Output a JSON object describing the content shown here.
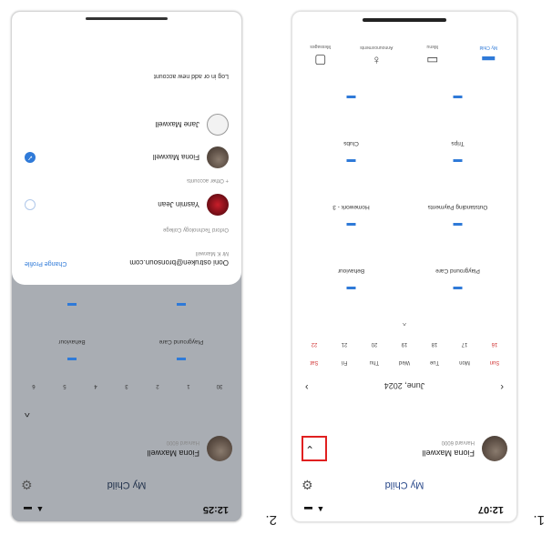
{
  "labels": {
    "first": "1.",
    "second": "2."
  },
  "screen1": {
    "time": "12:07",
    "status_icons": "▲ ▬",
    "title": "My Child",
    "child": {
      "name": "Fiona Maxwell",
      "subtitle": "Harvard 6000"
    },
    "month": "June, 2024",
    "prev": "‹",
    "next": "›",
    "days": [
      "Sun",
      "Mon",
      "Tue",
      "Wed",
      "Thu",
      "Fri",
      "Sat"
    ],
    "dates": [
      "16",
      "17",
      "18",
      "19",
      "20",
      "21",
      "22"
    ],
    "expand": "^",
    "tiles": [
      {
        "icon": "▬",
        "label": "Playground Care"
      },
      {
        "icon": "▬",
        "label": "Behaviour"
      },
      {
        "icon": "▬",
        "label": "Outstanding Payments"
      },
      {
        "icon": "▬",
        "label": "Homework - 3"
      },
      {
        "icon": "▬",
        "label": "Trips"
      },
      {
        "icon": "▬",
        "label": "Clubs"
      },
      {
        "icon": "▬",
        "label": ""
      },
      {
        "icon": "▬",
        "label": ""
      }
    ],
    "tabs": [
      {
        "icon": "▬",
        "label": "My Child"
      },
      {
        "icon": "▭",
        "label": "Menu"
      },
      {
        "icon": "♁",
        "label": "Announcements"
      },
      {
        "icon": "▢",
        "label": "Messages"
      }
    ]
  },
  "screen2": {
    "time": "12:25",
    "status_icons": "▲ ▬",
    "title": "My Child",
    "child": {
      "name": "Fiona Maxwell",
      "subtitle": "Harvard 6000"
    },
    "chevron": "^",
    "dates": [
      "30",
      "1",
      "2",
      "3",
      "4",
      "5",
      "6"
    ],
    "tiles": [
      {
        "icon": "▬",
        "label": "Playground Care"
      },
      {
        "icon": "▬",
        "label": "Behaviour"
      },
      {
        "icon": "▬",
        "label": ""
      },
      {
        "icon": "▬",
        "label": ""
      }
    ],
    "sheet": {
      "email": "Ooni ostruken@bronsoun.com",
      "email_sub": "Mr K Maxwell",
      "change": "Change Profile",
      "school": "Oxford Technology College",
      "account1": "Yasmin Jean",
      "other_header": "+ Other accounts",
      "account2": "Fiona Maxwell",
      "account3": "Jane Maxwell",
      "add_account": "Log in or add new account"
    }
  }
}
